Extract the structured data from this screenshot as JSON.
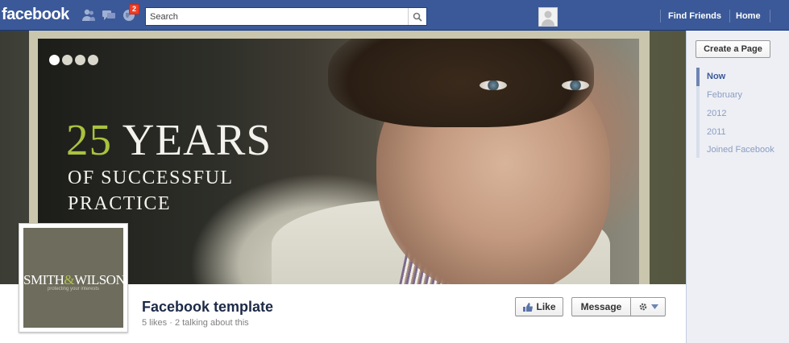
{
  "topbar": {
    "logo": "facebook",
    "notifications_badge": "2",
    "search_placeholder": "Search",
    "nav": [
      "Find Friends",
      "Home"
    ]
  },
  "cover": {
    "slides": 4,
    "active_slide": 1,
    "headline_number": "25",
    "headline_word": "YEARS",
    "subline1": "OF SUCCESSFUL",
    "subline2": "PRACTICE"
  },
  "profile": {
    "logo_text_left": "SMITH",
    "logo_amp": "&",
    "logo_text_right": "WILSON",
    "logo_tagline": "protecting your interests",
    "title": "Facebook template",
    "stats": "5 likes · 2 talking about this"
  },
  "actions": {
    "like": "Like",
    "message": "Message"
  },
  "sidebar": {
    "create_page": "Create a Page",
    "timeline": [
      "Now",
      "February",
      "2012",
      "2011",
      "Joined Facebook"
    ]
  },
  "colors": {
    "fb_blue": "#3b5998",
    "accent_green": "#a9c23f"
  }
}
